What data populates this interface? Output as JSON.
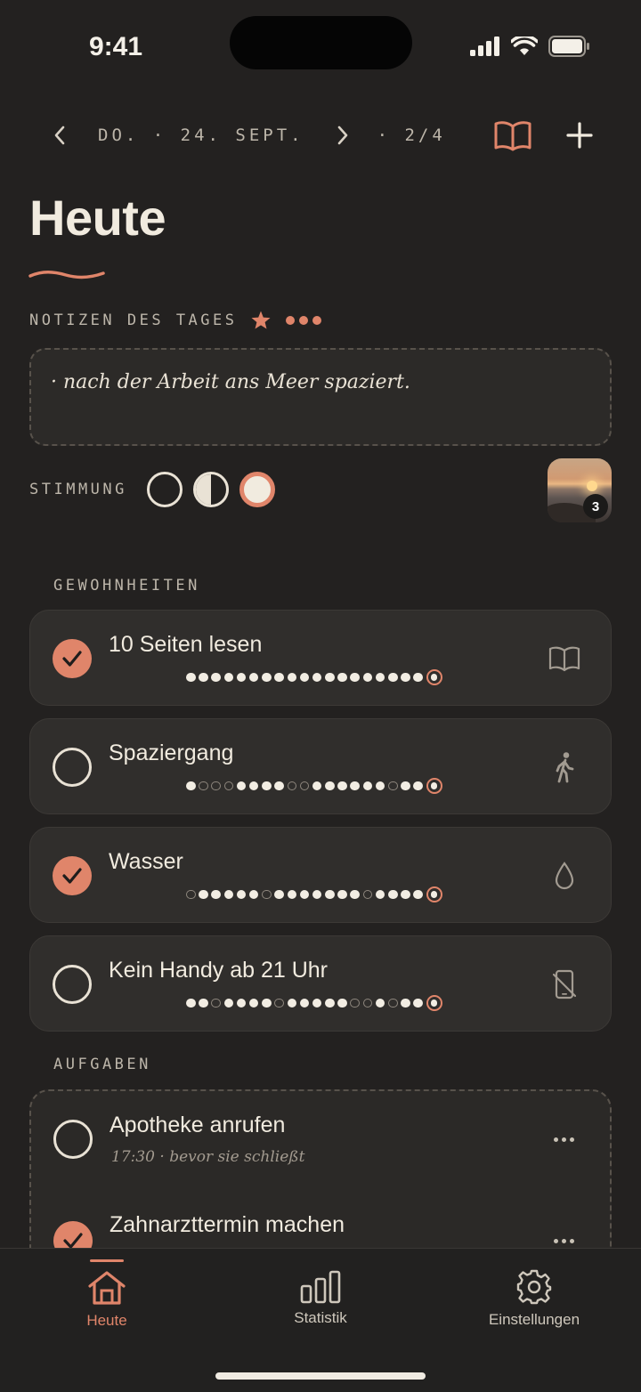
{
  "status_bar": {
    "time": "9:41"
  },
  "date_nav": {
    "date": "DO. · 24. SEPT.",
    "page": "· 2/4"
  },
  "page_title": "Heute",
  "notes": {
    "label": "NOTIZEN DES TAGES",
    "text": "· nach der Arbeit ans Meer spaziert."
  },
  "mood": {
    "label": "STIMMUNG",
    "options": [
      "empty",
      "half",
      "full"
    ],
    "selected": "full"
  },
  "photo": {
    "count": "3"
  },
  "habits": {
    "label": "GEWOHNHEITEN",
    "items": [
      {
        "name": "10 Seiten lesen",
        "done": true,
        "icon": "book-icon",
        "history": [
          1,
          1,
          1,
          1,
          1,
          1,
          1,
          1,
          1,
          1,
          1,
          1,
          1,
          1,
          1,
          1,
          1,
          1,
          1,
          1
        ]
      },
      {
        "name": "Spaziergang",
        "done": false,
        "icon": "walking-icon",
        "history": [
          1,
          0,
          0,
          0,
          1,
          1,
          1,
          1,
          0,
          0,
          1,
          1,
          1,
          1,
          1,
          1,
          0,
          1,
          1,
          1
        ]
      },
      {
        "name": "Wasser",
        "done": true,
        "icon": "water-drop-icon",
        "history": [
          0,
          1,
          1,
          1,
          1,
          1,
          0,
          1,
          1,
          1,
          1,
          1,
          1,
          1,
          0,
          1,
          1,
          1,
          1,
          1
        ]
      },
      {
        "name": "Kein Handy ab 21 Uhr",
        "done": false,
        "icon": "no-phone-icon",
        "history": [
          1,
          1,
          0,
          1,
          1,
          1,
          1,
          0,
          1,
          1,
          1,
          1,
          1,
          0,
          0,
          1,
          0,
          1,
          1,
          1
        ]
      }
    ]
  },
  "tasks": {
    "label": "AUFGABEN",
    "items": [
      {
        "name": "Apotheke anrufen",
        "note": "17:30 · bevor sie schließt",
        "done": false
      },
      {
        "name": "Zahnarzttermin machen",
        "note": "",
        "done": true
      }
    ]
  },
  "tabbar": {
    "home": "Heute",
    "stats": "Statistik",
    "settings": "Einstellungen",
    "active": "home"
  },
  "colors": {
    "accent": "#e0856a",
    "background": "#232120",
    "card": "#302e2c",
    "text": "#f1ebdf"
  }
}
